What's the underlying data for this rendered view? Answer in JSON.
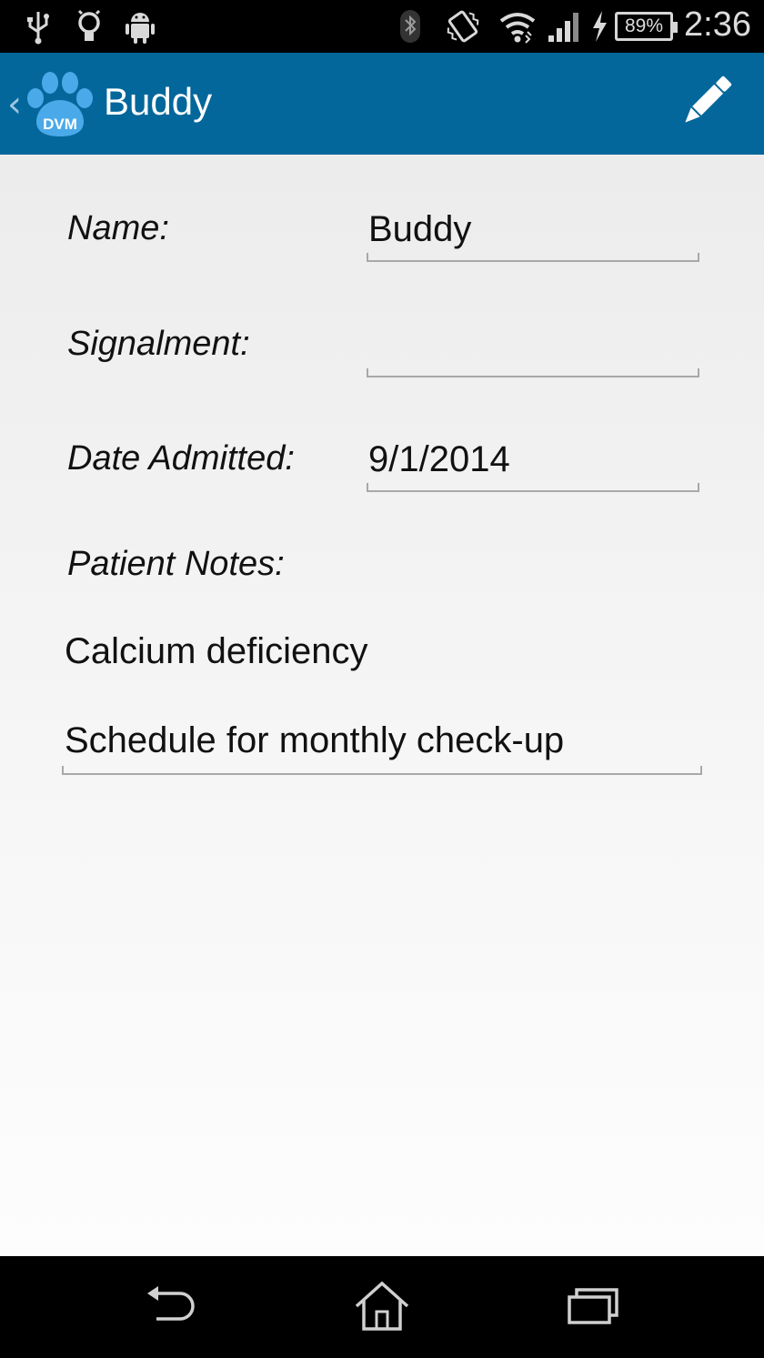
{
  "status_bar": {
    "time": "2:36",
    "battery_percent": "89%",
    "icons": [
      "usb-icon",
      "lightbulb-icon",
      "android-icon",
      "bluetooth-icon",
      "vibrate-icon",
      "wifi-icon",
      "signal-icon",
      "charging-icon"
    ]
  },
  "action_bar": {
    "title": "Buddy",
    "logo_text": "DVM",
    "actions": [
      "edit-icon"
    ],
    "colors": {
      "background": "#03679b",
      "logo": "#4aa9e8"
    }
  },
  "form": {
    "name": {
      "label": "Name:",
      "value": "Buddy"
    },
    "signalment": {
      "label": "Signalment:",
      "value": ""
    },
    "date_admitted": {
      "label": "Date Admitted:",
      "value": "9/1/2014"
    },
    "patient_notes": {
      "label": "Patient Notes:",
      "lines": [
        "Calcium deficiency",
        "Schedule for monthly check-up"
      ]
    }
  },
  "nav_bar": {
    "buttons": [
      "back-icon",
      "home-icon",
      "recents-icon"
    ]
  }
}
